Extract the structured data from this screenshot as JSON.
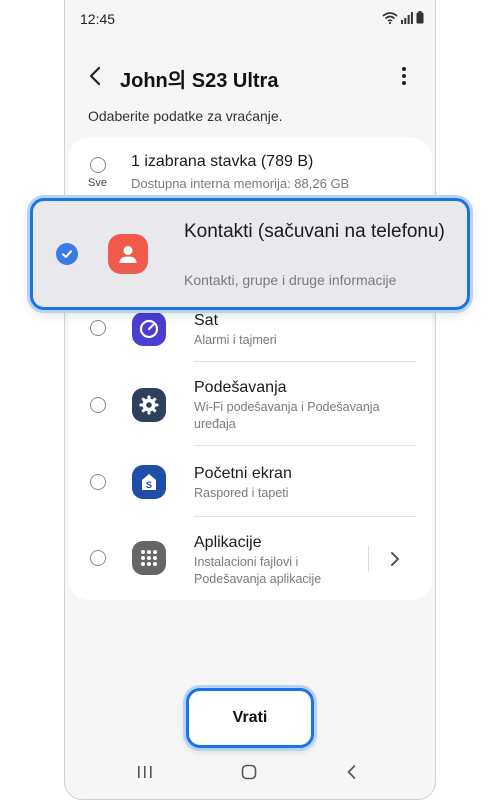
{
  "status_bar": {
    "time": "12:45",
    "icons": [
      "wifi-icon",
      "signal-icon",
      "battery-icon"
    ]
  },
  "header": {
    "title": "John의 S23 Ultra",
    "back_icon": "back-arrow-icon",
    "more_icon": "more-vert-icon"
  },
  "subtitle": "Odaberite podatke za vraćanje.",
  "select_all": {
    "label": "Sve",
    "title": "1 izabrana stavka (789 B)",
    "subtitle": "Dostupna interna memorija: 88,26 GB"
  },
  "highlighted_item": {
    "title": "Kontakti (sačuvani na telefonu)",
    "subtitle": "Kontakti, grupe i druge informacije",
    "checked": true,
    "icon": "contacts-icon",
    "color": "#ef5a4a"
  },
  "items": [
    {
      "title": "Sat",
      "subtitle": "Alarmi i tajmeri",
      "icon": "clock-icon",
      "color": "#4b3fd1"
    },
    {
      "title": "Podešavanja",
      "subtitle": "Wi-Fi podešavanja i Podešavanja uređaja",
      "icon": "settings-icon",
      "color": "#2f3f5e"
    },
    {
      "title": "Početni ekran",
      "subtitle": "Raspored i tapeti",
      "icon": "home-screen-icon",
      "color": "#1f4ea8"
    },
    {
      "title": "Aplikacije",
      "subtitle": "Instalacioni fajlovi i Podešavanja aplikacije",
      "icon": "apps-icon",
      "color": "#666666"
    }
  ],
  "restore_button": {
    "label": "Vrati"
  },
  "nav_bar": [
    "recents-icon",
    "home-icon",
    "back-icon"
  ],
  "accent_color": "#1a73e8"
}
